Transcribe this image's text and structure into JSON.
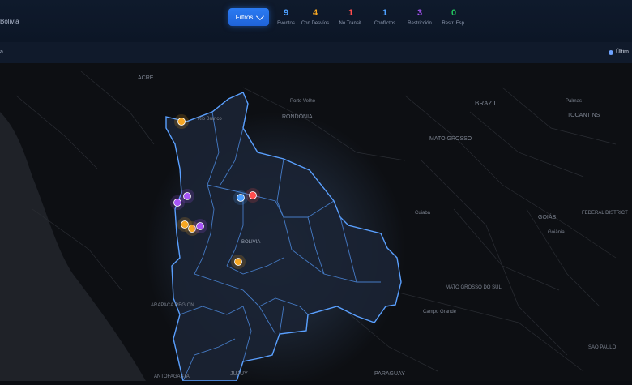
{
  "header": {
    "brand": "Bolivia",
    "filter_label": "Filtros",
    "stats": [
      {
        "value": "9",
        "label": "Eventos",
        "color": "#4ea0ff"
      },
      {
        "value": "4",
        "label": "Con Desvíos",
        "color": "#f5a623"
      },
      {
        "value": "1",
        "label": "No Transit.",
        "color": "#ff4d4d"
      },
      {
        "value": "1",
        "label": "Conflictos",
        "color": "#4ea0ff"
      },
      {
        "value": "3",
        "label": "Restricción",
        "color": "#a855f7"
      },
      {
        "value": "0",
        "label": "Restr. Esp.",
        "color": "#22c55e"
      }
    ]
  },
  "subbar": {
    "left_text": "a",
    "right_text": "Últim"
  },
  "map": {
    "labels": {
      "acre": "ACRE",
      "brazil": "BRAZIL",
      "rondonia": "RONDÔNIA",
      "mato_grosso": "MATO GROSSO",
      "tocantins": "TOCANTINS",
      "goias": "GOIÁS",
      "federal_district": "FEDERAL DISTRICT",
      "mato_grosso_sul": "MATO GROSSO DO SUL",
      "arapaca": "ARAPACÁ REGION",
      "antofagasta": "ANTOFAGASTA",
      "jujuy": "JUJUY",
      "paraguay": "PARAGUAY",
      "sao_paulo": "SÃO PAULO",
      "bolivia": "BOLIVIA",
      "palmas": "Palmas",
      "cuiaba": "Cuiabá",
      "goiania": "Goiânia",
      "campo_grande": "Campo Grande",
      "porto_velho": "Porto Velho",
      "rio_branco": "Rio Branco"
    },
    "markers": [
      {
        "type": "Con Desvíos",
        "color": "#f5a623"
      },
      {
        "type": "Conflictos",
        "color": "#4ea0ff"
      },
      {
        "type": "No Transit.",
        "color": "#ff4d4d"
      },
      {
        "type": "Restricción",
        "color": "#a855f7"
      },
      {
        "type": "Restricción",
        "color": "#a855f7"
      },
      {
        "type": "Con Desvíos",
        "color": "#f5a623"
      },
      {
        "type": "Con Desvíos",
        "color": "#f5a623"
      },
      {
        "type": "Restricción",
        "color": "#a855f7"
      },
      {
        "type": "Con Desvíos",
        "color": "#f5a623"
      }
    ]
  }
}
